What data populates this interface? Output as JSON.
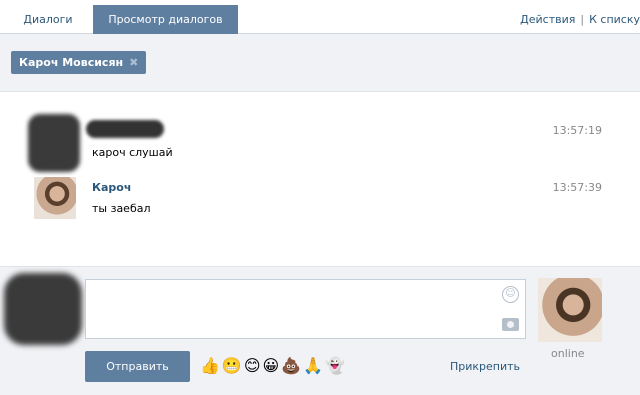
{
  "tabs": {
    "dialogs": "Диалоги",
    "view": "Просмотр диалогов",
    "actions": "Действия",
    "back": "К списку"
  },
  "chip": {
    "name": "Кароч Мовсисян"
  },
  "messages": [
    {
      "name": "",
      "text": "кароч слушай",
      "time": "13:57:19"
    },
    {
      "name": "Кароч",
      "text": "ты заебал",
      "time": "13:57:39"
    }
  ],
  "composer": {
    "send": "Отправить",
    "attach": "Прикрепить",
    "emojis": "👍😬😊😀💩🙏👻",
    "status": "online"
  }
}
